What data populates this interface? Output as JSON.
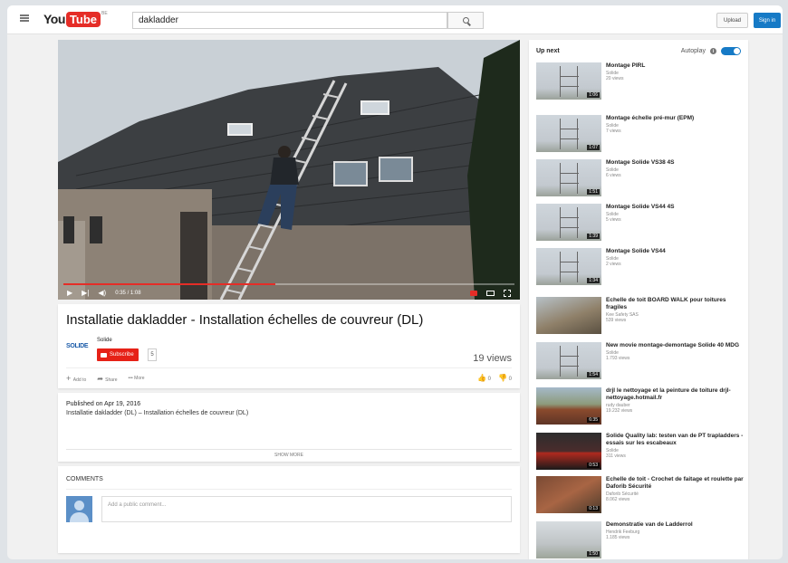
{
  "header": {
    "logo_you": "You",
    "logo_tube": "Tube",
    "logo_region": "BE",
    "search_value": "dakladder",
    "upload_label": "Upload",
    "signin_label": "Sign in"
  },
  "player": {
    "time": "0:35 / 1:08",
    "progress": 0.47
  },
  "video": {
    "title": "Installatie dakladder - Installation échelles de couvreur (DL)",
    "channel_logo": "SOLIDE",
    "channel_name": "Solide",
    "subscribe_label": "Subscribe",
    "subscriber_count": "5",
    "views": "19 views",
    "actions": {
      "add_to": "Add to",
      "share": "Share",
      "more": "More"
    },
    "likes": "0",
    "dislikes": "0"
  },
  "description": {
    "published": "Published on Apr 19, 2016",
    "text": "Installatie dakladder (DL) – Installation échelles de couvreur (DL)",
    "show_more": "SHOW MORE"
  },
  "comments": {
    "title": "COMMENTS",
    "placeholder": "Add a public comment..."
  },
  "sidebar": {
    "up_next": "Up next",
    "autoplay_label": "Autoplay",
    "autoplay_on": true,
    "items": [
      {
        "title": "Montage PIRL",
        "channel": "Solide",
        "views": "20 views",
        "duration": "1:06",
        "thumb": "scaffold"
      },
      {
        "title": "Montage échelle pré-mur (EPM)",
        "channel": "Solide",
        "views": "7 views",
        "duration": "1:07",
        "thumb": "scaffold"
      },
      {
        "title": "Montage Solide VS38 4S",
        "channel": "Solide",
        "views": "6 views",
        "duration": "1:51",
        "thumb": "scaffold"
      },
      {
        "title": "Montage Solide VS44 4S",
        "channel": "Solide",
        "views": "5 views",
        "duration": "1:39",
        "thumb": "scaffold"
      },
      {
        "title": "Montage Solide VS44",
        "channel": "Solide",
        "views": "2 views",
        "duration": "1:34",
        "thumb": "scaffold"
      },
      {
        "title": "Echelle de toit BOARD WALK pour toitures fragiles",
        "channel": "Kee Safety SAS",
        "views": "539 views",
        "duration": "",
        "thumb": "roof"
      },
      {
        "title": "New movie montage-demontage Solide 40 MDG",
        "channel": "Solide",
        "views": "1.793 views",
        "duration": "1:54",
        "thumb": "scaffold"
      },
      {
        "title": "drjl le nettoyage et la peinture de toiture drjl-nettoyage.hotmail.fr",
        "channel": "rudy dauber",
        "views": "19.232 views",
        "duration": "6:35",
        "thumb": "house"
      },
      {
        "title": "Solide Quality lab: testen van de PT trapladders - essais sur les escabeaux",
        "channel": "Solide",
        "views": "311 views",
        "duration": "0:53",
        "thumb": "dark"
      },
      {
        "title": "Echelle de toit - Crochet de faitage et roulette par Daforib Sécurité",
        "channel": "Daforib Sécurité",
        "views": "8.062 views",
        "duration": "0:13",
        "thumb": "tiles"
      },
      {
        "title": "Demonstratie van de Ladderrol",
        "channel": "Hendrik Feeburg",
        "views": "1.185 views",
        "duration": "1:50",
        "thumb": "ladder"
      }
    ]
  }
}
